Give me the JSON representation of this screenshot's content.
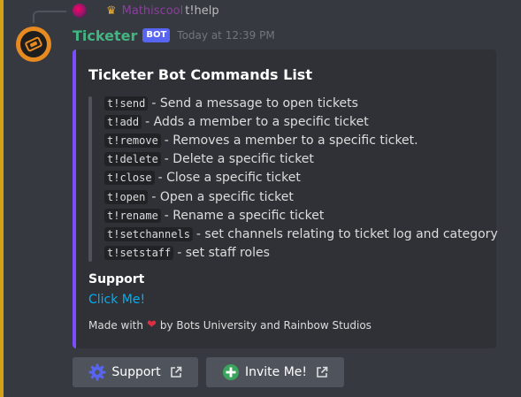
{
  "reply": {
    "avatar_icon": "user-avatar-icon",
    "crown_icon": "crown-icon",
    "username": "Mathiscool",
    "content": "t!help"
  },
  "message": {
    "username": "Ticketer",
    "bot_tag": "BOT",
    "timestamp": "Today at 12:39 PM"
  },
  "embed": {
    "title": "Ticketer Bot Commands List",
    "commands": [
      {
        "code": "t!send",
        "desc": "- Send a message to open tickets"
      },
      {
        "code": "t!add",
        "desc": "- Adds a member to a specific ticket"
      },
      {
        "code": "t!remove",
        "desc": "- Removes a member to a specific ticket."
      },
      {
        "code": "t!delete",
        "desc": "- Delete a specific ticket"
      },
      {
        "code": "t!close",
        "desc": "- Close a specific ticket"
      },
      {
        "code": "t!open",
        "desc": "- Open a specific ticket"
      },
      {
        "code": "t!rename",
        "desc": "- Rename a specific ticket"
      },
      {
        "code": "t!setchannels",
        "desc": "- set channels relating to ticket log and category"
      },
      {
        "code": "t!setstaff",
        "desc": "- set staff roles"
      }
    ],
    "field_name": "Support",
    "field_value": "Click Me!",
    "footer_prefix": "Made with",
    "footer_suffix": "by Bots University and Rainbow Studios"
  },
  "buttons": {
    "support_label": "Support",
    "invite_label": "Invite Me!"
  },
  "colors": {
    "embed_accent": "#7c4dff",
    "username": "#43b581",
    "bot_tag": "#5865f2",
    "link": "#00aff4"
  }
}
